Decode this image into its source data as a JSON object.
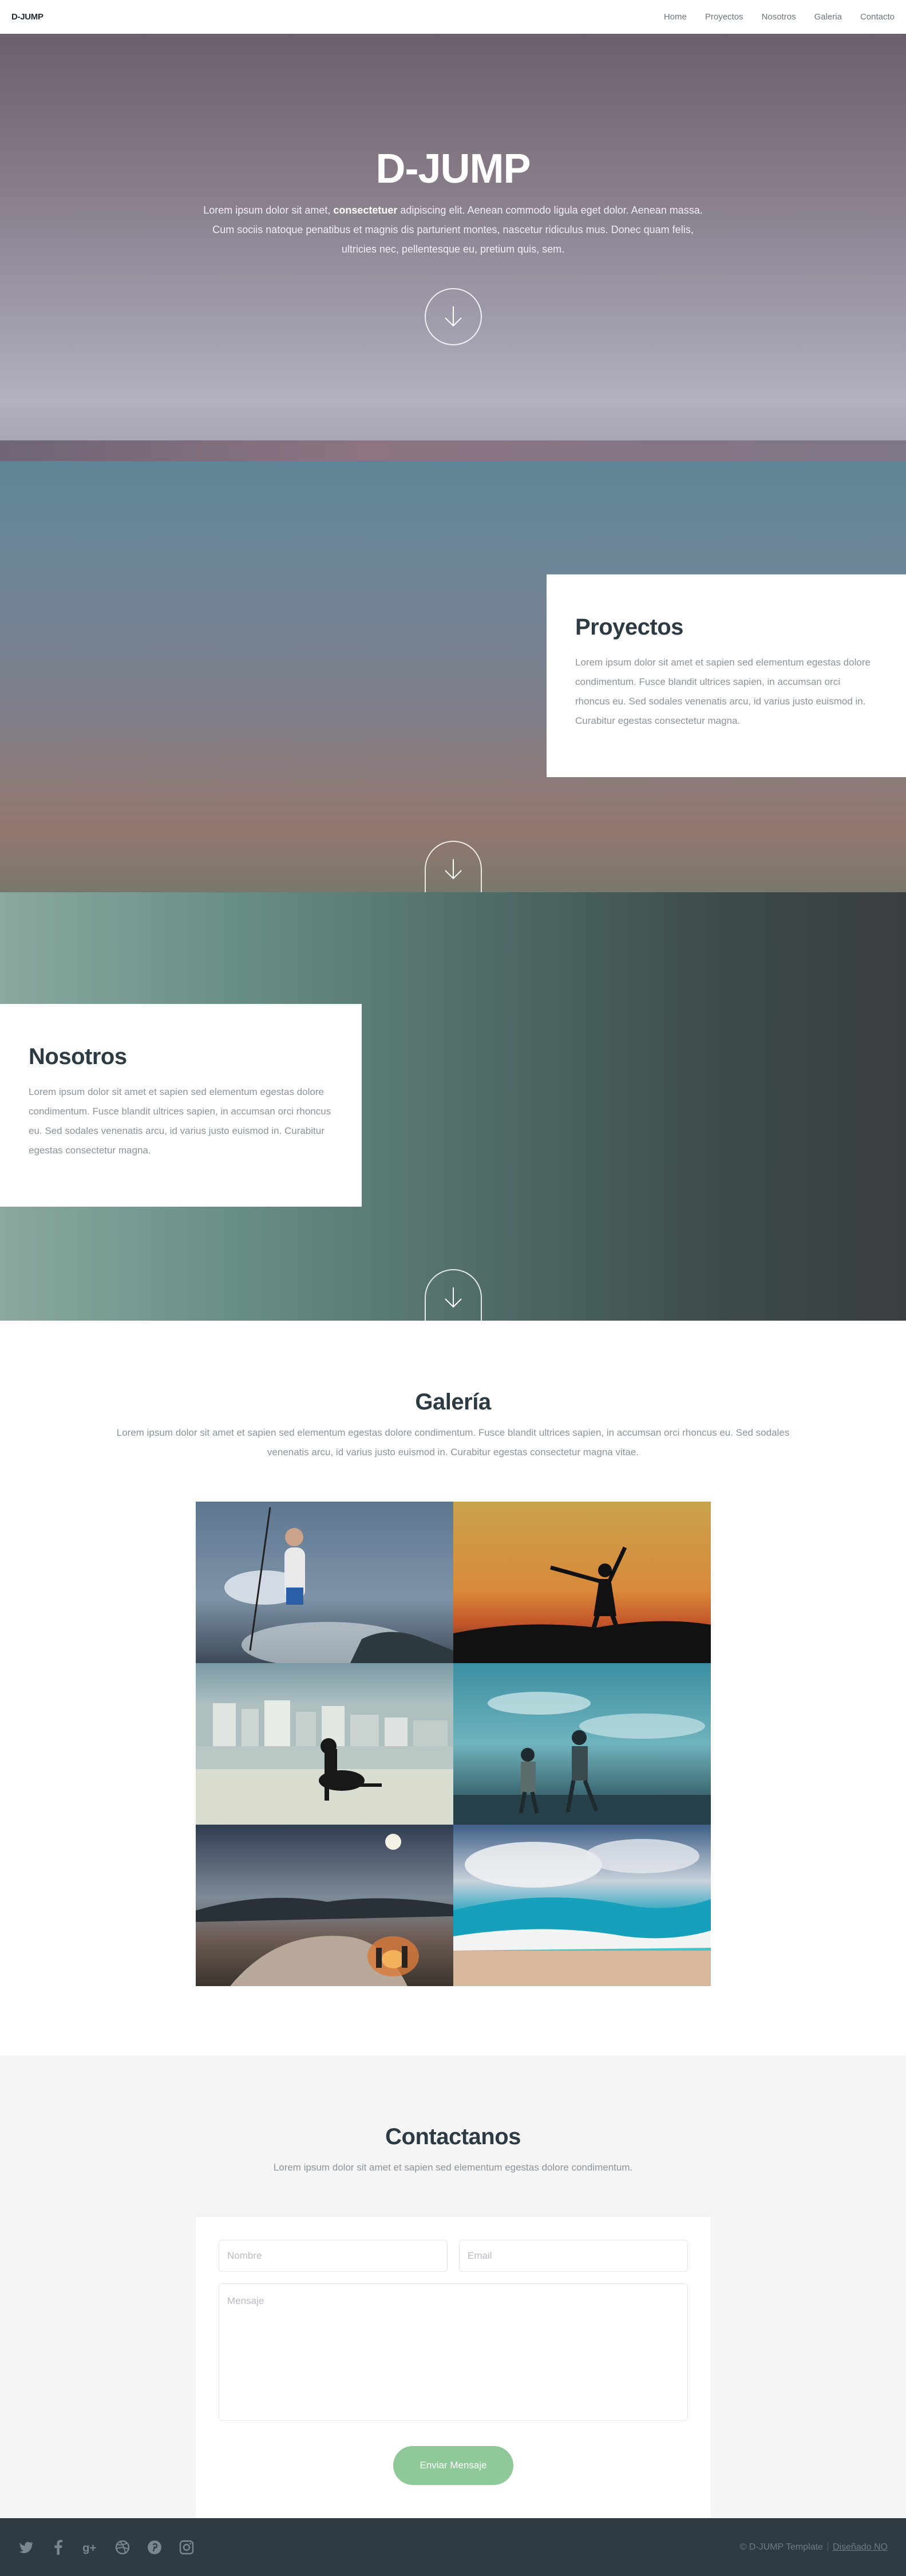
{
  "nav": {
    "brand": "D-JUMP",
    "links": [
      "Home",
      "Proyectos",
      "Nosotros",
      "Galeria",
      "Contacto"
    ]
  },
  "hero": {
    "title": "D-JUMP",
    "text_before": "Lorem ipsum dolor sit amet, ",
    "text_bold": "consectetuer",
    "text_after": " adipiscing elit. Aenean commodo ligula eget dolor. Aenean massa. Cum sociis natoque penatibus et magnis dis parturient montes, nascetur ridiculus mus. Donec quam felis, ultricies nec, pellentesque eu, pretium quis, sem.",
    "scroll_icon": "arrow-down-icon"
  },
  "proyectos": {
    "title": "Proyectos",
    "text": "Lorem ipsum dolor sit amet et sapien sed elementum egestas dolore condimentum. Fusce blandit ultrices sapien, in accumsan orci rhoncus eu. Sed sodales venenatis arcu, id varius justo euismod in. Curabitur egestas consectetur magna."
  },
  "nosotros": {
    "title": "Nosotros",
    "text": "Lorem ipsum dolor sit amet et sapien sed elementum egestas dolore condimentum. Fusce blandit ultrices sapien, in accumsan orci rhoncus eu. Sed sodales venenatis arcu, id varius justo euismod in. Curabitur egestas consectetur magna."
  },
  "galeria": {
    "title": "Galería",
    "text": "Lorem ipsum dolor sit amet et sapien sed elementum egestas dolore condimentum. Fusce blandit ultrices sapien, in accumsan orci rhoncus eu. Sed sodales venenatis arcu, id varius justo euismod in. Curabitur egestas consectetur magna vitae.",
    "images": [
      "surfer-photo",
      "sunset-jump-photo",
      "beach-dog-photo",
      "couple-beach-photo",
      "night-campfire-photo",
      "wave-photo"
    ]
  },
  "contacto": {
    "title": "Contactanos",
    "text": "Lorem ipsum dolor sit amet et sapien sed elementum egestas dolore condimentum.",
    "name_placeholder": "Nombre",
    "email_placeholder": "Email",
    "message_placeholder": "Mensaje",
    "send_label": "Enviar Mensaje"
  },
  "footer": {
    "socials": [
      "twitter-icon",
      "facebook-icon",
      "google-plus-icon",
      "dribbble-icon",
      "pinterest-icon",
      "instagram-icon"
    ],
    "copyright": "© D-JUMP Template",
    "credit": "Diseñado NO"
  },
  "colors": {
    "accent_green": "#8fc99a",
    "dark": "#2f3a42",
    "muted": "#8a949b"
  }
}
